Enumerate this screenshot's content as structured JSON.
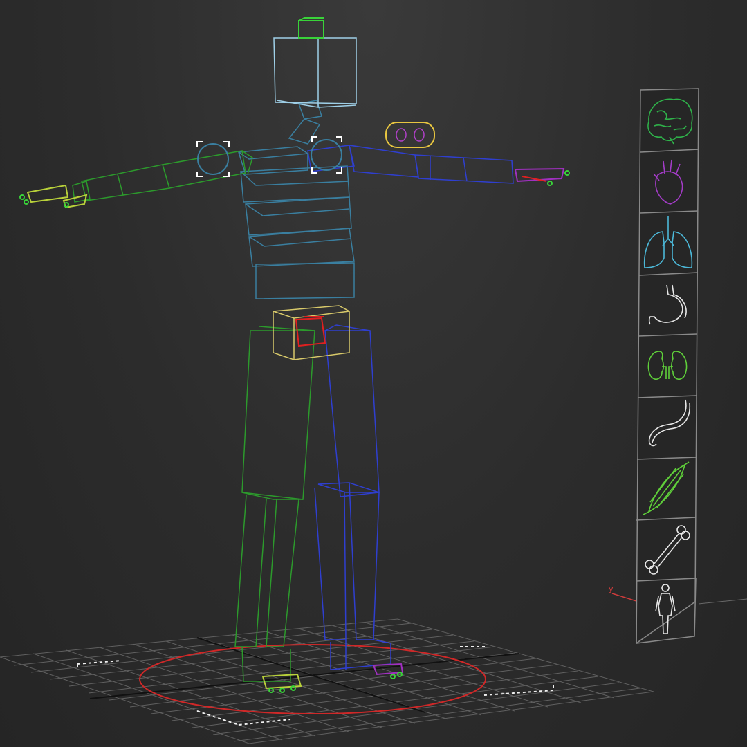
{
  "viewport": {
    "axis_label": "y",
    "background": "#2b2b2b"
  },
  "rig": {
    "colors": {
      "head": "#9fd0e8",
      "head_tip": "#39d339",
      "spine": "#3a7fa0",
      "left_arm": "#2c9a2c",
      "right_arm": "#2f3fd0",
      "left_leg": "#2c9a2c",
      "right_leg": "#2f3fd0",
      "pelvis": "#d8c96a",
      "com": "#e02020",
      "ground_circle": "#d02828",
      "fingers_left": "#b9d13a",
      "fingers_right": "#a030c0",
      "eyes": "#e8c640",
      "eye_dots": "#b040c8",
      "grid": "#6a6a6a"
    }
  },
  "organ_panel": {
    "icons": [
      {
        "name": "brain-icon",
        "color": "#2fb34a"
      },
      {
        "name": "heart-icon",
        "color": "#a43cc8"
      },
      {
        "name": "lungs-icon",
        "color": "#4cb8d8"
      },
      {
        "name": "stomach-icon",
        "color": "#e8e8e8"
      },
      {
        "name": "kidneys-icon",
        "color": "#5fcf3a"
      },
      {
        "name": "intestine-icon",
        "color": "#e8e8e8"
      },
      {
        "name": "muscle-icon",
        "color": "#5fcf3a"
      },
      {
        "name": "bone-icon",
        "color": "#e8e8e8"
      },
      {
        "name": "body-icon",
        "color": "#e8e8e8"
      }
    ]
  }
}
